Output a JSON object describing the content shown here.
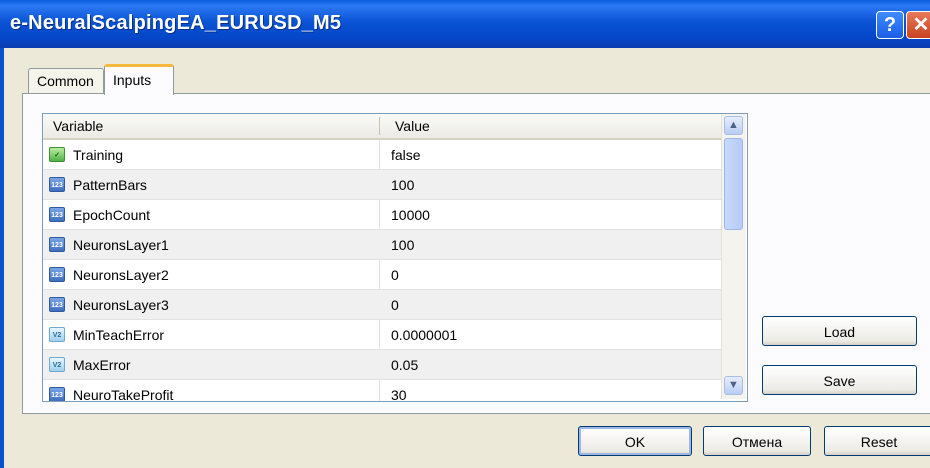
{
  "window": {
    "title": "e-NeuralScalpingEA_EURUSD_M5",
    "help_label": "?",
    "close_label": "✕"
  },
  "tabs": [
    {
      "label": "Common",
      "active": false
    },
    {
      "label": "Inputs",
      "active": true
    }
  ],
  "grid": {
    "columns": {
      "variable": "Variable",
      "value": "Value"
    },
    "rows": [
      {
        "icon": "bool-icon",
        "variable": "Training",
        "value": "false"
      },
      {
        "icon": "int-icon",
        "variable": "PatternBars",
        "value": "100"
      },
      {
        "icon": "int-icon",
        "variable": "EpochCount",
        "value": "10000"
      },
      {
        "icon": "int-icon",
        "variable": "NeuronsLayer1",
        "value": "100"
      },
      {
        "icon": "int-icon",
        "variable": "NeuronsLayer2",
        "value": "0"
      },
      {
        "icon": "int-icon",
        "variable": "NeuronsLayer3",
        "value": "0"
      },
      {
        "icon": "double-icon",
        "variable": "MinTeachError",
        "value": "0.0000001"
      },
      {
        "icon": "double-icon",
        "variable": "MaxError",
        "value": "0.05"
      },
      {
        "icon": "int-icon",
        "variable": "NeuroTakeProfit",
        "value": "30"
      }
    ]
  },
  "buttons": {
    "load": "Load",
    "save": "Save",
    "ok": "OK",
    "cancel": "Отмена",
    "reset": "Reset"
  }
}
